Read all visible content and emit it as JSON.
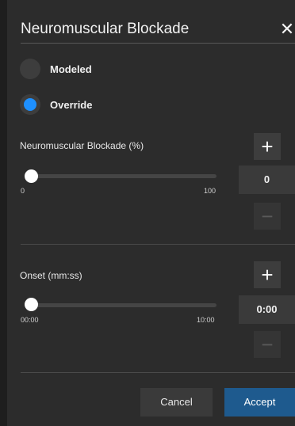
{
  "dialog": {
    "title": "Neuromuscular Blockade",
    "close_icon": "close-icon"
  },
  "mode": {
    "options": [
      {
        "label": "Modeled",
        "selected": false
      },
      {
        "label": "Override",
        "selected": true
      }
    ]
  },
  "blockade": {
    "label": "Neuromuscular Blockade (%)",
    "value": "0",
    "min_label": "0",
    "max_label": "100",
    "slider_fraction": 0
  },
  "onset": {
    "label": "Onset (mm:ss)",
    "value": "0:00",
    "min_label": "00:00",
    "max_label": "10:00",
    "slider_fraction": 0
  },
  "steppers": {
    "plus": "+",
    "minus": "−"
  },
  "footer": {
    "cancel_label": "Cancel",
    "accept_label": "Accept"
  },
  "colors": {
    "accent": "#1e90ff",
    "accept_button": "#1e5a8e",
    "background": "#2c2c2c"
  }
}
